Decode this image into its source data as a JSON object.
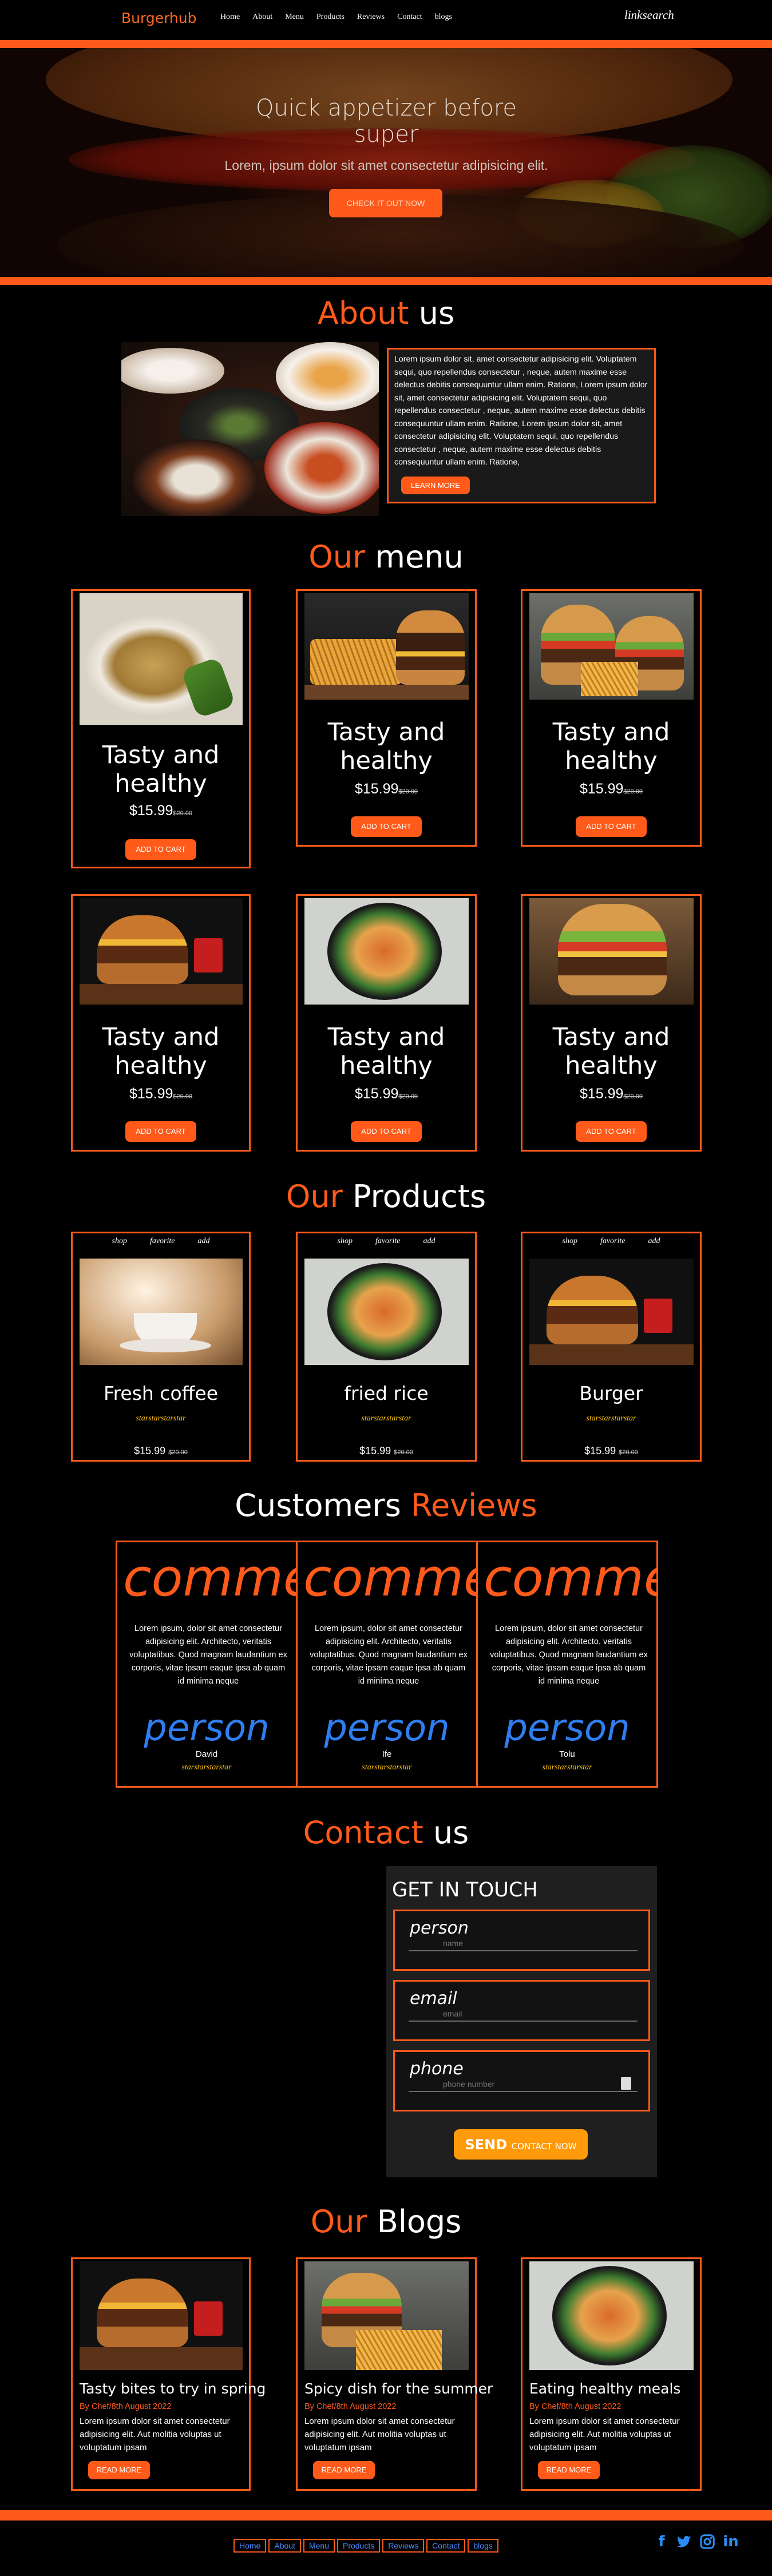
{
  "nav": {
    "brand": "Burgerhub",
    "links": [
      "Home",
      "About",
      "Menu",
      "Products",
      "Reviews",
      "Contact",
      "blogs"
    ],
    "search": "linksearch"
  },
  "hero": {
    "title": "Quick appetizer before super",
    "subtitle": "Lorem, ipsum dolor sit amet consectetur adipisicing elit.",
    "button": "CHECK IT OUT NOW"
  },
  "about": {
    "title_accent": "About",
    "title_rest": "us",
    "text": "Lorem ipsum dolor sit, amet consectetur adipisicing elit. Voluptatem sequi, quo repellendus consectetur , neque, autem maxime esse delectus debitis consequuntur ullam enim. Ratione, Lorem ipsum dolor sit, amet consectetur adipisicing elit. Voluptatem sequi, quo repellendus consectetur , neque, autem maxime esse delectus debitis consequuntur ullam enim. Ratione, Lorem ipsum dolor sit, amet consectetur adipisicing elit. Voluptatem sequi, quo repellendus consectetur , neque, autem maxime esse delectus debitis consequuntur ullam enim. Ratione,",
    "button": "LEARN MORE"
  },
  "menu": {
    "title_accent": "Our",
    "title_rest": "menu",
    "items": [
      {
        "title": "Tasty and healthy",
        "price": "$15.99",
        "old": "$20.00",
        "button": "ADD TO CART"
      },
      {
        "title": "Tasty and healthy",
        "price": "$15.99",
        "old": "$20.00",
        "button": "ADD TO CART"
      },
      {
        "title": "Tasty and healthy",
        "price": "$15.99",
        "old": "$20.00",
        "button": "ADD TO CART"
      },
      {
        "title": "Tasty and healthy",
        "price": "$15.99",
        "old": "$20.00",
        "button": "ADD TO CART"
      },
      {
        "title": "Tasty and healthy",
        "price": "$15.99",
        "old": "$20.00",
        "button": "ADD TO CART"
      },
      {
        "title": "Tasty and healthy",
        "price": "$15.99",
        "old": "$20.00",
        "button": "ADD TO CART"
      }
    ]
  },
  "products": {
    "title_accent": "Our",
    "title_rest": "Products",
    "actions": [
      "shop",
      "favorite",
      "add"
    ],
    "items": [
      {
        "name": "Fresh coffee",
        "stars": "starstarstarstar",
        "price": "$15.99",
        "old": "$20.00"
      },
      {
        "name": "fried rice",
        "stars": "starstarstarstar",
        "price": "$15.99",
        "old": "$20.00"
      },
      {
        "name": "Burger",
        "stars": "starstarstarstar",
        "price": "$15.99",
        "old": "$20.00"
      }
    ]
  },
  "reviews": {
    "title_rest": "Customers",
    "title_accent": "Reviews",
    "items": [
      {
        "comment": "comment",
        "text": "Lorem ipsum, dolor sit amet consectetur adipisicing elit. Architecto, veritatis voluptatibus. Quod magnam laudantium ex corporis, vitae ipsam eaque ipsa ab quam id minima neque",
        "person": "person",
        "name": "David",
        "stars": "starstarstarstar"
      },
      {
        "comment": "comment",
        "text": "Lorem ipsum, dolor sit amet consectetur adipisicing elit. Architecto, veritatis voluptatibus. Quod magnam laudantium ex corporis, vitae ipsam eaque ipsa ab quam id minima neque",
        "person": "person",
        "name": "Ife",
        "stars": "starstarstarstar"
      },
      {
        "comment": "comment",
        "text": "Lorem ipsum, dolor sit amet consectetur adipisicing elit. Architecto, veritatis voluptatibus. Quod magnam laudantium ex corporis, vitae ipsam eaque ipsa ab quam id minima neque",
        "person": "person",
        "name": "Tolu",
        "stars": "starstarstarstar"
      }
    ]
  },
  "contact": {
    "title_accent": "Contact",
    "title_rest": "us",
    "heading": "GET IN TOUCH",
    "fields": [
      {
        "label": "person",
        "placeholder": "name"
      },
      {
        "label": "email",
        "placeholder": "email"
      },
      {
        "label": "phone",
        "placeholder": "phone number"
      }
    ],
    "send": "SEND",
    "send_small": "CONTACT NOW"
  },
  "blogs": {
    "title_accent": "Our",
    "title_rest": "Blogs",
    "items": [
      {
        "title": "Tasty bites to try in spring",
        "meta": "By Chef/8th August 2022",
        "text": "Lorem ipsum dolor sit amet consectetur adipisicing elit. Aut molitia voluptas ut voluptatum ipsam",
        "button": "READ MORE"
      },
      {
        "title": "Spicy dish for the summer",
        "meta": "By Chef/8th August 2022",
        "text": "Lorem ipsum dolor sit amet consectetur adipisicing elit. Aut molitia voluptas ut voluptatum ipsam",
        "button": "READ MORE"
      },
      {
        "title": "Eating healthy meals",
        "meta": "By Chef/8th August 2022",
        "text": "Lorem ipsum dolor sit amet consectetur adipisicing elit. Aut molitia voluptas ut voluptatum ipsam",
        "button": "READ MORE"
      }
    ]
  },
  "footer": {
    "links": [
      "Home",
      "About",
      "Menu",
      "Products",
      "Reviews",
      "Contact",
      "blogs"
    ],
    "social": [
      "facebook-icon",
      "twitter-icon",
      "instagram-icon",
      "linkedin-icon"
    ]
  },
  "colors": {
    "accent": "#ff5a1a",
    "person_blue": "#2f7ef1",
    "stars": "#ffc107",
    "send": "#ff9a0a"
  }
}
